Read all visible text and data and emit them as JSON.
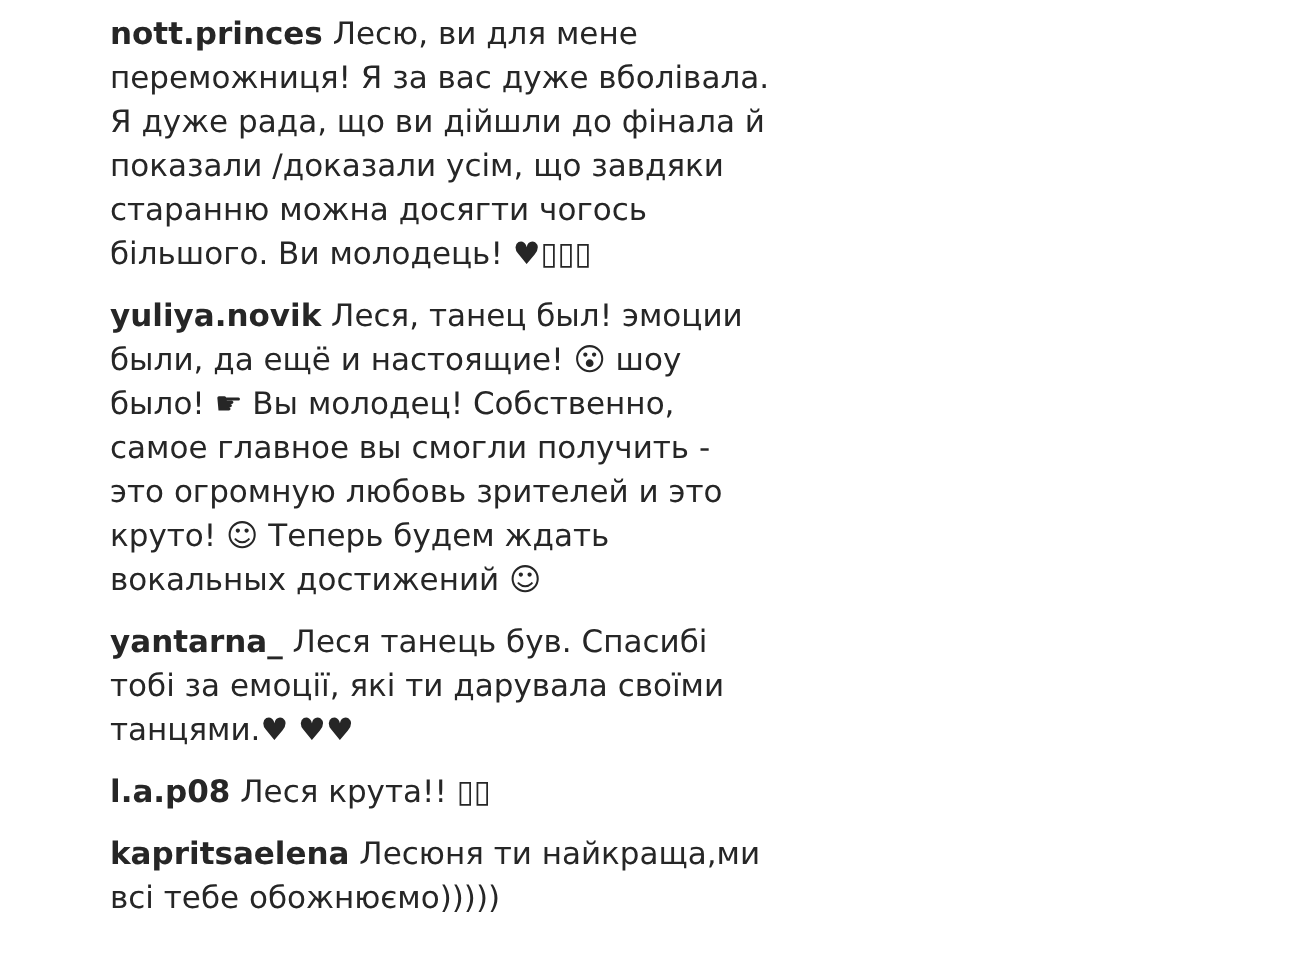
{
  "comments": [
    {
      "username": "nott.princes",
      "text": "Лесю, ви для мене переможниця! Я за вас дуже вболівала. Я дуже рада, що ви дійшли до фінала й показали /доказали усім, що завдяки старанню можна досягти чогось більшого. Ви молодець! ♥▯▯▯"
    },
    {
      "username": "yuliya.novik",
      "text": "Леся, танец был! эмоции были, да ещё и настоящие! 😮 шоу было! ☛ Вы молодец! Собственно, самое главное вы смогли получить - это огромную любовь зрителей и это круто! ☺ Теперь будем ждать вокальных достижений ☺"
    },
    {
      "username": "yantarna_",
      "text": "Леся танець був. Спасибі тобі за емоції, які ти дарувала своїми танцями.♥ ♥♥"
    },
    {
      "username": "l.a.p08",
      "text": "Леся крута!! ▯▯"
    },
    {
      "username": "kapritsaelena",
      "text": "Лесюня ти найкраща,ми всі тебе обожнюємо)))))"
    }
  ]
}
